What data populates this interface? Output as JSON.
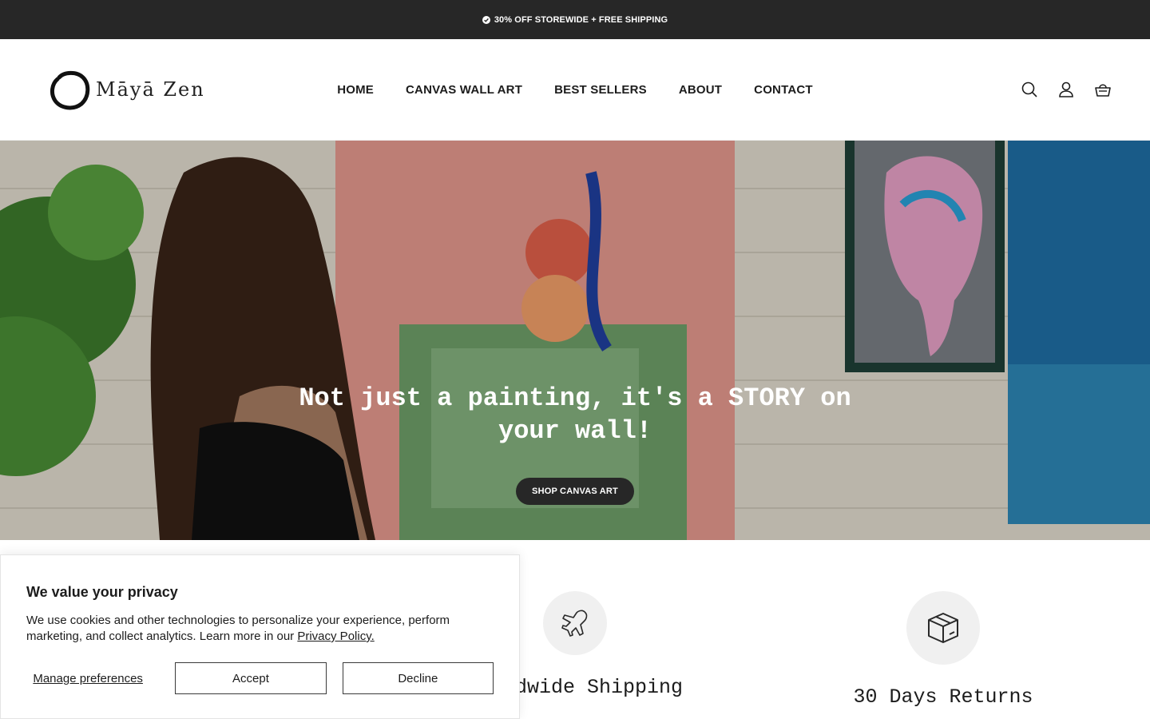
{
  "announcement": {
    "text": "30% OFF STOREWIDE + FREE SHIPPING",
    "icon": "check-circle-icon"
  },
  "header": {
    "logo_text": "Māyā Zen",
    "nav": [
      {
        "label": "HOME"
      },
      {
        "label": "CANVAS WALL ART"
      },
      {
        "label": "BEST SELLERS"
      },
      {
        "label": "ABOUT"
      },
      {
        "label": "CONTACT"
      }
    ],
    "icons": [
      "search-icon",
      "account-icon",
      "cart-icon"
    ]
  },
  "hero": {
    "title": "Not just a painting, it's a STORY on your wall!",
    "button_label": "SHOP CANVAS ART"
  },
  "features": [
    {
      "title": "Worldwide Shipping",
      "icon": "airplane-icon"
    },
    {
      "title": "30 Days Returns",
      "icon": "box-icon"
    }
  ],
  "cookie": {
    "title": "We value your privacy",
    "body": "We use cookies and other technologies to personalize your experience, perform marketing, and collect analytics. Learn more in our",
    "link_label": "Privacy Policy.",
    "manage_label": "Manage preferences",
    "accept_label": "Accept",
    "decline_label": "Decline"
  },
  "colors": {
    "announcement_bg": "#272727",
    "button_bg": "#272727",
    "feature_circle": "#f0f0f0"
  }
}
